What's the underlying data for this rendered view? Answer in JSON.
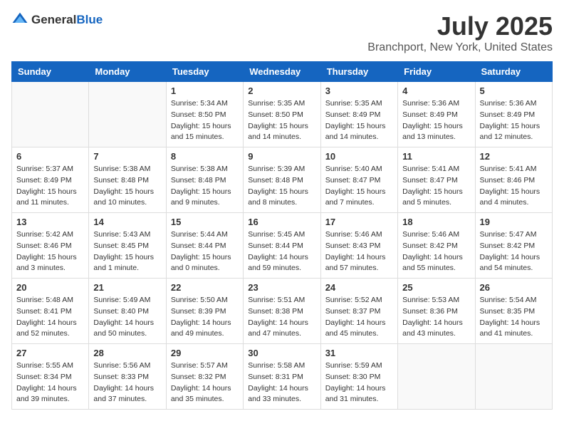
{
  "header": {
    "logo_general": "General",
    "logo_blue": "Blue",
    "title": "July 2025",
    "subtitle": "Branchport, New York, United States"
  },
  "calendar": {
    "days_of_week": [
      "Sunday",
      "Monday",
      "Tuesday",
      "Wednesday",
      "Thursday",
      "Friday",
      "Saturday"
    ],
    "weeks": [
      [
        {
          "day": "",
          "info": ""
        },
        {
          "day": "",
          "info": ""
        },
        {
          "day": "1",
          "info": "Sunrise: 5:34 AM\nSunset: 8:50 PM\nDaylight: 15 hours and 15 minutes."
        },
        {
          "day": "2",
          "info": "Sunrise: 5:35 AM\nSunset: 8:50 PM\nDaylight: 15 hours and 14 minutes."
        },
        {
          "day": "3",
          "info": "Sunrise: 5:35 AM\nSunset: 8:49 PM\nDaylight: 15 hours and 14 minutes."
        },
        {
          "day": "4",
          "info": "Sunrise: 5:36 AM\nSunset: 8:49 PM\nDaylight: 15 hours and 13 minutes."
        },
        {
          "day": "5",
          "info": "Sunrise: 5:36 AM\nSunset: 8:49 PM\nDaylight: 15 hours and 12 minutes."
        }
      ],
      [
        {
          "day": "6",
          "info": "Sunrise: 5:37 AM\nSunset: 8:49 PM\nDaylight: 15 hours and 11 minutes."
        },
        {
          "day": "7",
          "info": "Sunrise: 5:38 AM\nSunset: 8:48 PM\nDaylight: 15 hours and 10 minutes."
        },
        {
          "day": "8",
          "info": "Sunrise: 5:38 AM\nSunset: 8:48 PM\nDaylight: 15 hours and 9 minutes."
        },
        {
          "day": "9",
          "info": "Sunrise: 5:39 AM\nSunset: 8:48 PM\nDaylight: 15 hours and 8 minutes."
        },
        {
          "day": "10",
          "info": "Sunrise: 5:40 AM\nSunset: 8:47 PM\nDaylight: 15 hours and 7 minutes."
        },
        {
          "day": "11",
          "info": "Sunrise: 5:41 AM\nSunset: 8:47 PM\nDaylight: 15 hours and 5 minutes."
        },
        {
          "day": "12",
          "info": "Sunrise: 5:41 AM\nSunset: 8:46 PM\nDaylight: 15 hours and 4 minutes."
        }
      ],
      [
        {
          "day": "13",
          "info": "Sunrise: 5:42 AM\nSunset: 8:46 PM\nDaylight: 15 hours and 3 minutes."
        },
        {
          "day": "14",
          "info": "Sunrise: 5:43 AM\nSunset: 8:45 PM\nDaylight: 15 hours and 1 minute."
        },
        {
          "day": "15",
          "info": "Sunrise: 5:44 AM\nSunset: 8:44 PM\nDaylight: 15 hours and 0 minutes."
        },
        {
          "day": "16",
          "info": "Sunrise: 5:45 AM\nSunset: 8:44 PM\nDaylight: 14 hours and 59 minutes."
        },
        {
          "day": "17",
          "info": "Sunrise: 5:46 AM\nSunset: 8:43 PM\nDaylight: 14 hours and 57 minutes."
        },
        {
          "day": "18",
          "info": "Sunrise: 5:46 AM\nSunset: 8:42 PM\nDaylight: 14 hours and 55 minutes."
        },
        {
          "day": "19",
          "info": "Sunrise: 5:47 AM\nSunset: 8:42 PM\nDaylight: 14 hours and 54 minutes."
        }
      ],
      [
        {
          "day": "20",
          "info": "Sunrise: 5:48 AM\nSunset: 8:41 PM\nDaylight: 14 hours and 52 minutes."
        },
        {
          "day": "21",
          "info": "Sunrise: 5:49 AM\nSunset: 8:40 PM\nDaylight: 14 hours and 50 minutes."
        },
        {
          "day": "22",
          "info": "Sunrise: 5:50 AM\nSunset: 8:39 PM\nDaylight: 14 hours and 49 minutes."
        },
        {
          "day": "23",
          "info": "Sunrise: 5:51 AM\nSunset: 8:38 PM\nDaylight: 14 hours and 47 minutes."
        },
        {
          "day": "24",
          "info": "Sunrise: 5:52 AM\nSunset: 8:37 PM\nDaylight: 14 hours and 45 minutes."
        },
        {
          "day": "25",
          "info": "Sunrise: 5:53 AM\nSunset: 8:36 PM\nDaylight: 14 hours and 43 minutes."
        },
        {
          "day": "26",
          "info": "Sunrise: 5:54 AM\nSunset: 8:35 PM\nDaylight: 14 hours and 41 minutes."
        }
      ],
      [
        {
          "day": "27",
          "info": "Sunrise: 5:55 AM\nSunset: 8:34 PM\nDaylight: 14 hours and 39 minutes."
        },
        {
          "day": "28",
          "info": "Sunrise: 5:56 AM\nSunset: 8:33 PM\nDaylight: 14 hours and 37 minutes."
        },
        {
          "day": "29",
          "info": "Sunrise: 5:57 AM\nSunset: 8:32 PM\nDaylight: 14 hours and 35 minutes."
        },
        {
          "day": "30",
          "info": "Sunrise: 5:58 AM\nSunset: 8:31 PM\nDaylight: 14 hours and 33 minutes."
        },
        {
          "day": "31",
          "info": "Sunrise: 5:59 AM\nSunset: 8:30 PM\nDaylight: 14 hours and 31 minutes."
        },
        {
          "day": "",
          "info": ""
        },
        {
          "day": "",
          "info": ""
        }
      ]
    ]
  }
}
